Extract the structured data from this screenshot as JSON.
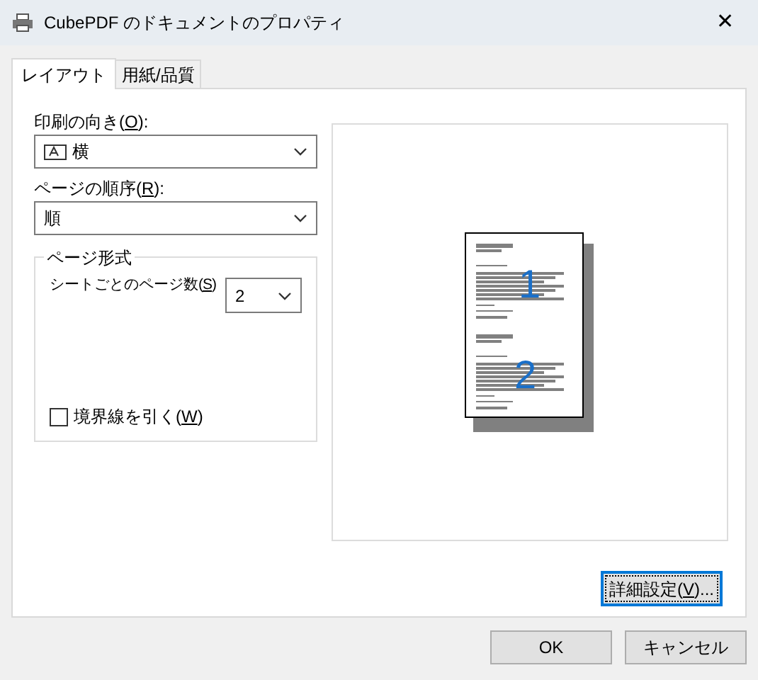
{
  "window": {
    "title": "CubePDF のドキュメントのプロパティ",
    "close": "✕"
  },
  "tabs": [
    {
      "label": "レイアウト",
      "selected": true
    },
    {
      "label": "用紙/品質",
      "selected": false
    }
  ],
  "orientation": {
    "label": [
      "印刷の向き(",
      "O",
      "):"
    ],
    "value": "横"
  },
  "page_order": {
    "label": [
      "ページの順序(",
      "R",
      "):"
    ],
    "value": "順"
  },
  "page_format": {
    "title": "ページ形式",
    "pages_per_sheet": {
      "label": [
        "シートごとのページ数(",
        "S",
        ")"
      ],
      "value": "2"
    },
    "draw_borders": {
      "label": [
        "境界線を引く(",
        "W",
        ")"
      ],
      "checked": false
    }
  },
  "preview": {
    "page_numbers": [
      "1",
      "2"
    ]
  },
  "advanced_button": {
    "label": [
      "詳細設定(",
      "V",
      ")..."
    ]
  },
  "buttons": [
    "OK",
    "キャンセル"
  ]
}
